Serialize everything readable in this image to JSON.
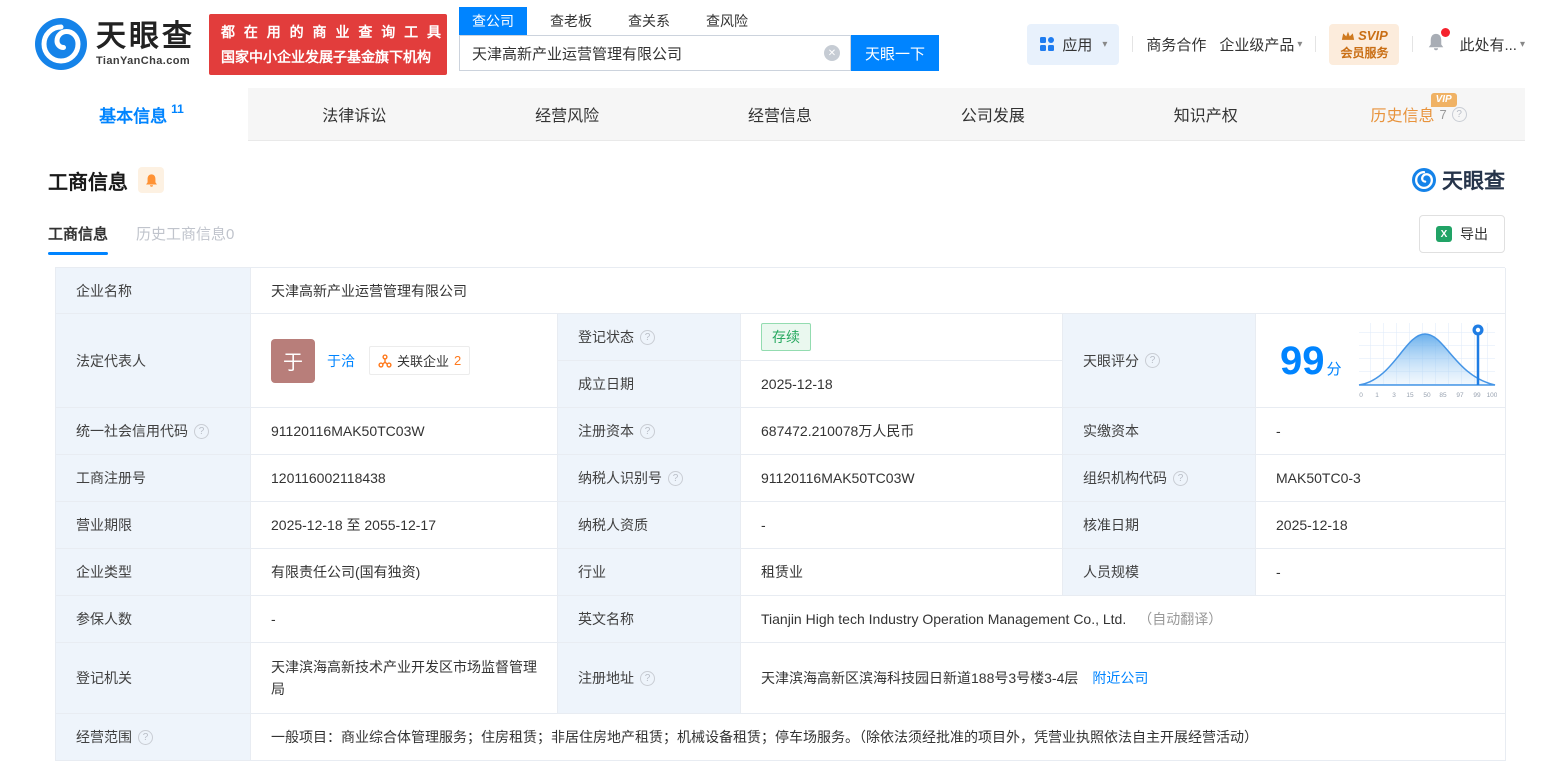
{
  "glyphs": {
    "caret": "▾",
    "clear": "✕",
    "help": "?",
    "excel": "X"
  },
  "colors": {
    "accent": "#0084ff",
    "promo_red": "#e23d3c",
    "status_green": "#28a960",
    "history_orange": "#e8933c"
  },
  "header": {
    "logo": {
      "brand": "天眼查",
      "domain": "TianYanCha.com"
    },
    "promo": {
      "line1": "都 在 用 的 商 业 查 询 工 具",
      "line2": "国家中小企业发展子基金旗下机构"
    },
    "search": {
      "tabs": [
        {
          "label": "查公司",
          "active": true
        },
        {
          "label": "查老板"
        },
        {
          "label": "查关系"
        },
        {
          "label": "查风险"
        }
      ],
      "value": "天津高新产业运营管理有限公司",
      "button": "天眼一下"
    },
    "nav": {
      "apps": "应用",
      "biz": "商务合作",
      "enterprise": "企业级产品",
      "svip_line1": "SVIP",
      "svip_line2": "会员服务",
      "user": "此处有..."
    }
  },
  "tabs": [
    {
      "label": "基本信息",
      "count": "11",
      "active": true
    },
    {
      "label": "法律诉讼"
    },
    {
      "label": "经营风险"
    },
    {
      "label": "经营信息"
    },
    {
      "label": "公司发展"
    },
    {
      "label": "知识产权"
    },
    {
      "label": "历史信息",
      "count": "7",
      "vip_badge": "VIP"
    }
  ],
  "section": {
    "title": "工商信息",
    "watermark": "天眼查",
    "subtabs": [
      {
        "label": "工商信息",
        "active": true
      },
      {
        "label": "历史工商信息0"
      }
    ],
    "export_label": "导出"
  },
  "fields": {
    "company_name": {
      "label": "企业名称",
      "value": "天津高新产业运营管理有限公司"
    },
    "legal_rep": {
      "label": "法定代表人",
      "name": "于洽",
      "avatar_char": "于",
      "related_label": "关联企业",
      "related_count": "2"
    },
    "reg_status": {
      "label": "登记状态",
      "value": "存续"
    },
    "establish_date": {
      "label": "成立日期",
      "value": "2025-12-18"
    },
    "tyc_score": {
      "label": "天眼评分",
      "score": "99",
      "unit": "分"
    },
    "credit_code": {
      "label": "统一社会信用代码",
      "value": "91120116MAK50TC03W"
    },
    "reg_capital": {
      "label": "注册资本",
      "value": "687472.210078万人民币"
    },
    "paid_capital": {
      "label": "实缴资本",
      "value": "-"
    },
    "reg_number": {
      "label": "工商注册号",
      "value": "120116002118438"
    },
    "taxpayer_id": {
      "label": "纳税人识别号",
      "value": "91120116MAK50TC03W"
    },
    "org_code": {
      "label": "组织机构代码",
      "value": "MAK50TC0-3"
    },
    "business_term": {
      "label": "营业期限",
      "value": "2025-12-18 至 2055-12-17"
    },
    "taxpayer_quality": {
      "label": "纳税人资质",
      "value": "-"
    },
    "approval_date": {
      "label": "核准日期",
      "value": "2025-12-18"
    },
    "company_type": {
      "label": "企业类型",
      "value": "有限责任公司(国有独资)"
    },
    "industry": {
      "label": "行业",
      "value": "租赁业"
    },
    "staff_size": {
      "label": "人员规模",
      "value": "-"
    },
    "insured_count": {
      "label": "参保人数",
      "value": "-"
    },
    "english_name": {
      "label": "英文名称",
      "value": "Tianjin High tech Industry Operation Management Co., Ltd.",
      "note": "（自动翻译）"
    },
    "reg_authority": {
      "label": "登记机关",
      "value": "天津滨海高新技术产业开发区市场监督管理局"
    },
    "reg_address": {
      "label": "注册地址",
      "value": "天津滨海高新区滨海科技园日新道188号3号楼3-4层",
      "link": "附近公司"
    },
    "business_scope": {
      "label": "经营范围",
      "value": "一般项目：商业综合体管理服务；住房租赁；非居住房地产租赁；机械设备租赁；停车场服务。（除依法须经批准的项目外，凭营业执照依法自主开展经营活动）"
    }
  },
  "score_chart": {
    "type": "area",
    "score": 99,
    "marker_value": 99,
    "x_labels": [
      "0",
      "1",
      "3",
      "15",
      "50",
      "85",
      "97",
      "99",
      "100"
    ]
  }
}
